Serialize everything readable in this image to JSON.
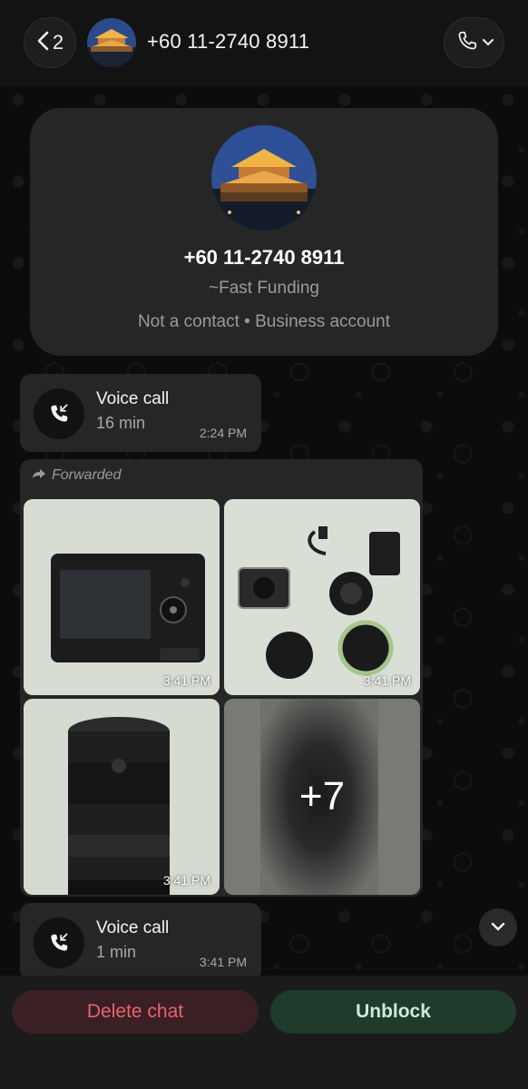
{
  "header": {
    "back_count": "2",
    "title": "+60 11-2740 8911"
  },
  "contact": {
    "name": "+60 11-2740 8911",
    "alias": "~Fast Funding",
    "meta": "Not a contact • Business account"
  },
  "messages": {
    "call1": {
      "title": "Voice call",
      "duration": "16 min",
      "time": "2:24 PM"
    },
    "album": {
      "forwarded_label": "Forwarded",
      "photos": [
        {
          "time": "3:41 PM"
        },
        {
          "time": "3:41 PM"
        },
        {
          "time": "3:41 PM"
        }
      ],
      "more_count": "+7"
    },
    "call2": {
      "title": "Voice call",
      "duration": "1 min",
      "time": "3:41 PM"
    }
  },
  "actions": {
    "delete_label": "Delete chat",
    "unblock_label": "Unblock"
  },
  "colors": {
    "delete": "#e8646d",
    "unblock": "#1f3b2b"
  }
}
